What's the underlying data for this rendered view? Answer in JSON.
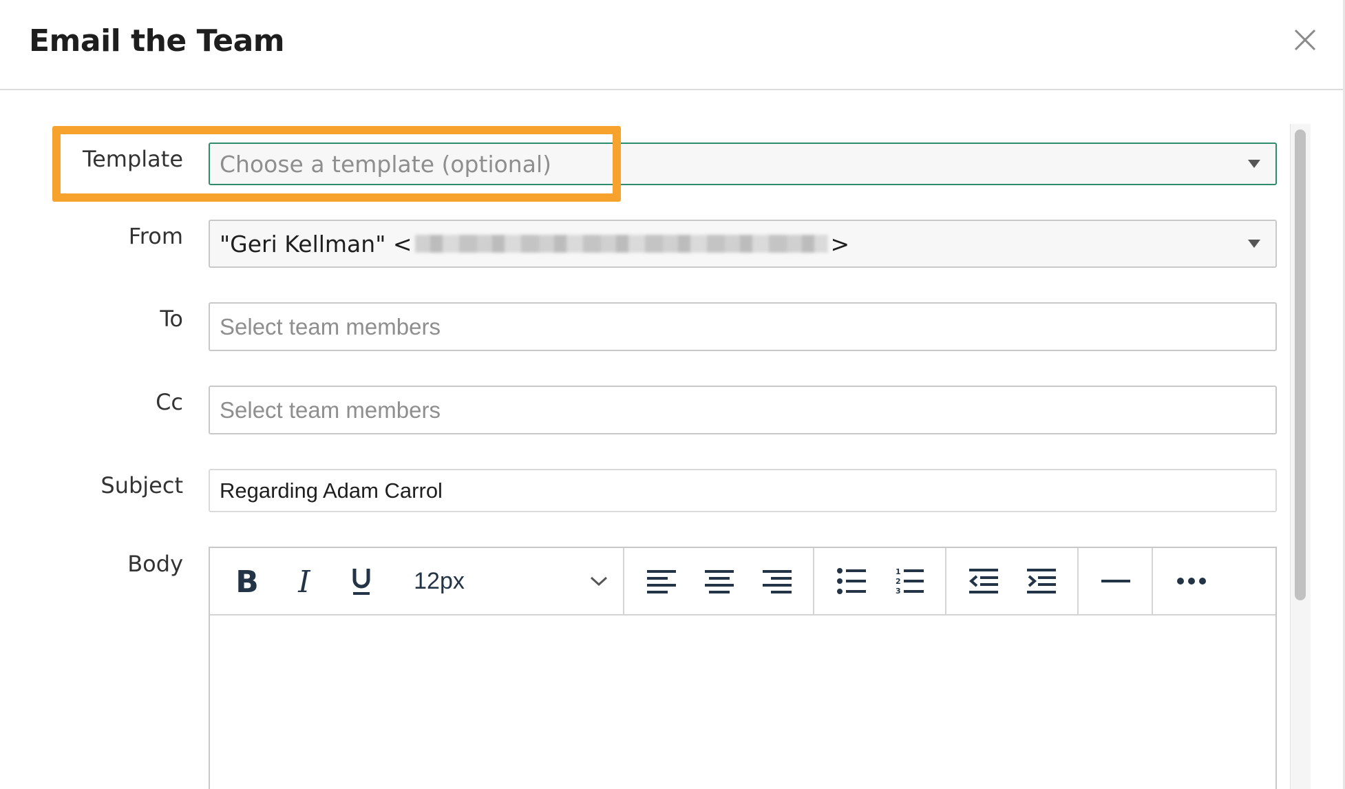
{
  "modal": {
    "title": "Email the Team"
  },
  "form": {
    "template": {
      "label": "Template",
      "placeholder": "Choose a template (optional)"
    },
    "from": {
      "label": "From",
      "name_prefix": "\"Geri Kellman\" <",
      "name_suffix": ">"
    },
    "to": {
      "label": "To",
      "placeholder": "Select team members"
    },
    "cc": {
      "label": "Cc",
      "placeholder": "Select team members"
    },
    "subject": {
      "label": "Subject",
      "value": "Regarding Adam Carrol"
    },
    "body": {
      "label": "Body",
      "font_size": "12px"
    }
  },
  "icons": {
    "close": "close-icon",
    "bold": "bold-icon",
    "italic": "italic-icon",
    "underline": "underline-icon",
    "align_left": "align-left-icon",
    "align_center": "align-center-icon",
    "align_right": "align-right-icon",
    "bullet_list": "bullet-list-icon",
    "numbered_list": "numbered-list-icon",
    "outdent": "outdent-icon",
    "indent": "indent-icon",
    "horizontal_rule": "horizontal-rule-icon",
    "more": "more-icon"
  },
  "colors": {
    "highlight": "#f7a22c",
    "focus_border": "#2e8b6a",
    "icon": "#243447"
  }
}
